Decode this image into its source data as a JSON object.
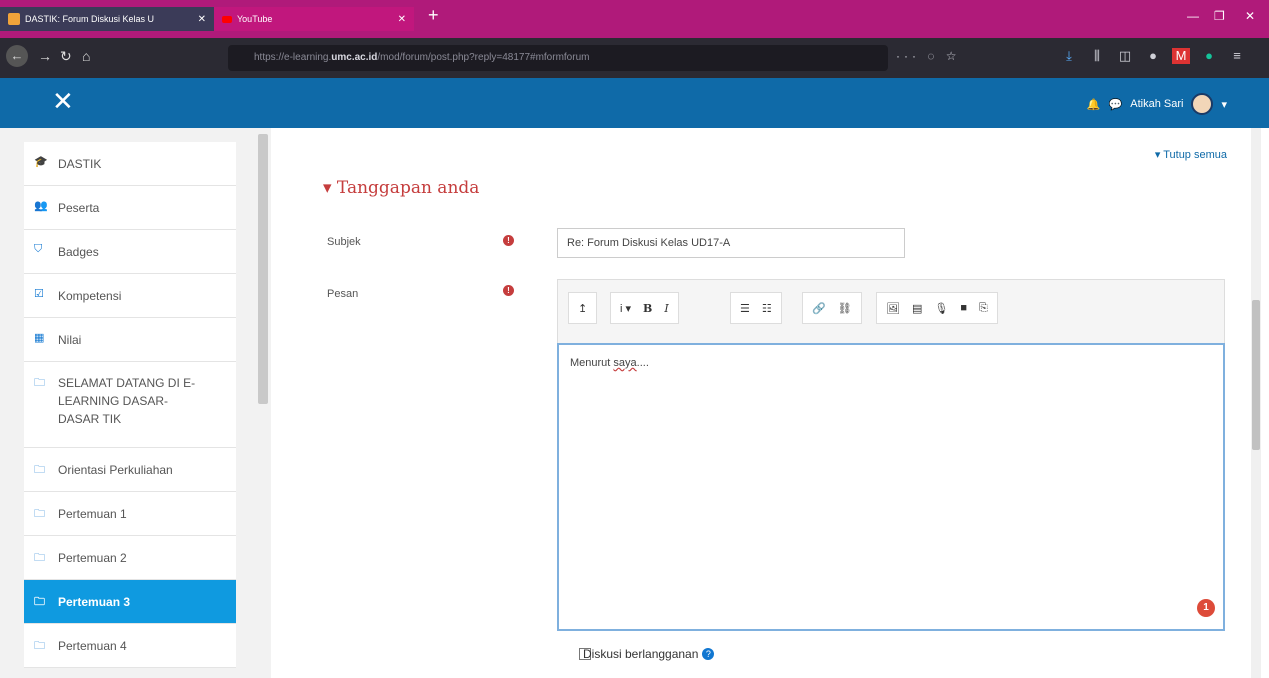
{
  "browser": {
    "tabs": [
      {
        "label": "DASTIK: Forum Diskusi Kelas U",
        "active": true
      },
      {
        "label": "YouTube",
        "active": false
      }
    ],
    "new_tab": "+",
    "url_prefix": "https://e-learning.",
    "url_domain": "umc.ac.id",
    "url_path": "/mod/forum/post.php?reply=48177#mformforum",
    "url_actions": "··· ◌ ☆"
  },
  "moodle": {
    "close_icon": "✕",
    "user_name": "Atikah Sari",
    "colors": {
      "header": "#0f6aa8",
      "accent": "#c53d3d",
      "active": "#0f9ae0"
    }
  },
  "sidebar": {
    "items": [
      {
        "icon": "graduation-cap-icon",
        "glyph": "🎓",
        "label": "DASTIK"
      },
      {
        "icon": "users-icon",
        "glyph": "👥",
        "label": "Peserta"
      },
      {
        "icon": "shield-icon",
        "glyph": "⛉",
        "label": "Badges"
      },
      {
        "icon": "check-square-icon",
        "glyph": "☑",
        "label": "Kompetensi"
      },
      {
        "icon": "table-icon",
        "glyph": "▦",
        "label": "Nilai"
      },
      {
        "icon": "folder-icon",
        "glyph": "🗀",
        "label": "SELAMAT DATANG DI E-LEARNING DASAR-DASAR TIK"
      },
      {
        "icon": "folder-icon",
        "glyph": "🗀",
        "label": "Orientasi Perkuliahan"
      },
      {
        "icon": "folder-icon",
        "glyph": "🗀",
        "label": "Pertemuan 1"
      },
      {
        "icon": "folder-icon",
        "glyph": "🗀",
        "label": "Pertemuan 2"
      },
      {
        "icon": "folder-icon",
        "glyph": "🗀",
        "label": "Pertemuan 3",
        "active": true
      },
      {
        "icon": "folder-icon",
        "glyph": "🗀",
        "label": "Pertemuan 4"
      }
    ]
  },
  "form": {
    "collapse_all": "▾ Tutup semua",
    "section_title": "▾ Tanggapan anda",
    "subject_label": "Subjek",
    "subject_value": "Re: Forum Diskusi Kelas UD17-A",
    "message_label": "Pesan",
    "message_value_plain": "Menurut ",
    "message_value_underlined": "saya",
    "message_value_suffix": "....",
    "editor_badge": "1",
    "subscribe_label": "Diskusi berlangganan",
    "help": "?"
  },
  "toolbar": {
    "groups": [
      [
        "↥"
      ],
      [
        "i ▾",
        "B",
        "I"
      ],
      [
        "☰",
        "☷"
      ],
      [
        "🔗",
        "⛓"
      ],
      [
        "🖼",
        "▤",
        "🎙",
        "■",
        "⎘"
      ]
    ]
  }
}
